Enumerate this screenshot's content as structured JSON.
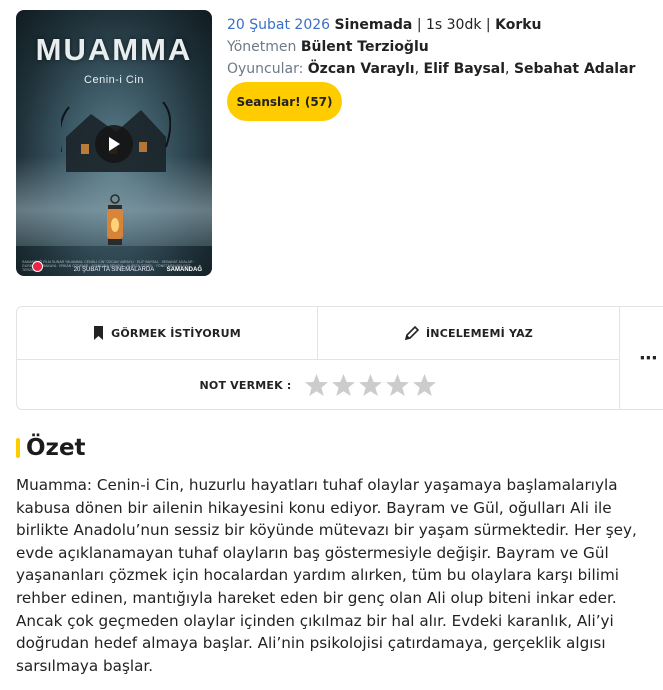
{
  "poster": {
    "title": "MUAMMA",
    "subtitle": "Cenin-i Cin",
    "credits": "SAMANDAĞ FİLM SUNAR “MUAMMA: CENİN-İ CİN” ÖZCAN VARAYLI · ELİF BAYSAL · SEBAHAT ADALAR · GURBAN KARAKAYA · ERKAN ÖZDEMİR · SÜMEYRA ŞENGÜL · ALİRIZA ÖZBEK · YÖNETMEN BÜLENT TERZİOĞLU",
    "release": "20 ŞUBAT'TA SİNEMALARDA",
    "brand": "SAMANDAĞ"
  },
  "meta": {
    "date": "20 Şubat 2026",
    "status": "Sinemada",
    "duration": "1s 30dk",
    "genre": "Korku",
    "director_label": "Yönetmen",
    "director": "Bülent Terzioğlu",
    "cast_label": "Oyuncular:",
    "cast": [
      "Özcan Varaylı",
      "Elif Baysal",
      "Sebahat Adalar"
    ],
    "separator": "|",
    "comma": ","
  },
  "seans_button": "Seanslar! (57)",
  "actions": {
    "watch_label": "GÖRMEK İSTİYORUM",
    "review_label": "İNCELEMEMİ YAZ",
    "rate_label": "NOT VERMEK :",
    "more": "⋯",
    "star_count": 5,
    "rating": 0
  },
  "summary": {
    "heading": "Özet",
    "text": "Muamma: Cenin-i Cin, huzurlu hayatları tuhaf olaylar yaşamaya başlamalarıyla kabusa dönen bir ailenin hikayesini konu ediyor. Bayram ve Gül, oğulları Ali ile birlikte Anadolu’nun sessiz bir köyünde mütevazı bir yaşam sürmektedir. Her şey, evde açıklanamayan tuhaf olayların baş göstermesiyle değişir. Bayram ve Gül yaşananları çözmek için hocalardan yardım alırken, tüm bu olaylara karşı bilimi rehber edinen, mantığıyla hareket eden bir genç olan Ali olup biteni inkar eder. Ancak çok geçmeden olaylar içinden çıkılmaz bir hal alır. Evdeki karanlık, Ali’yi doğrudan hedef almaya başlar. Ali’nin psikolojisi çatırdamaya, gerçeklik algısı sarsılmaya başlar."
  },
  "colors": {
    "accent": "#ffcc00",
    "link_blue": "#3a6ec7",
    "muted": "#6d7a87",
    "star_empty": "#cccccc"
  }
}
